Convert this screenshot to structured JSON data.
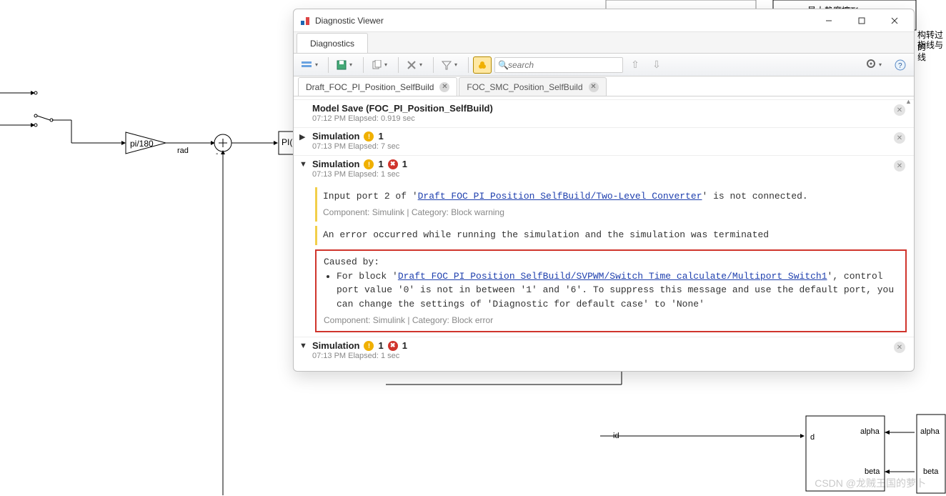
{
  "window": {
    "title": "Diagnostic Viewer",
    "tab": "Diagnostics"
  },
  "toolbar": {
    "search_placeholder": "search"
  },
  "model_tabs": [
    {
      "label": "Draft_FOC_PI_Position_SelfBuild"
    },
    {
      "label": "FOC_SMC_Position_SelfBuild"
    }
  ],
  "entries": {
    "e0": {
      "title": "Model Save (FOC_PI_Position_SelfBuild)",
      "meta": "07:12 PM   Elapsed: 0.919 sec"
    },
    "e1": {
      "title_prefix": "Simulation",
      "warn_count": "1",
      "meta": "07:13 PM   Elapsed: 7 sec"
    },
    "e2": {
      "title_prefix": "Simulation",
      "warn_count": "1",
      "err_count": "1",
      "meta": "07:13 PM   Elapsed: 1 sec",
      "warning": {
        "pre": "Input port 2 of '",
        "link": "Draft_FOC_PI_Position_SelfBuild/Two-Level Converter",
        "post": "' is not connected.",
        "footer": "Component:  Simulink | Category:  Block warning"
      },
      "errmsg_hdr": "An error occurred while running the simulation and the simulation was terminated",
      "causedby": "Caused by:",
      "err_pre": "For block '",
      "err_link": "Draft_FOC_PI_Position_SelfBuild/SVPWM/Switch Time calculate/Multiport Switch1",
      "err_post": "', control port value '0' is not in between '1' and '6'. To suppress this message and use the default port, you can change the settings of 'Diagnostic for default case' to 'None'",
      "err_footer": "Component:  Simulink | Category:  Block error"
    },
    "e3": {
      "title_prefix": "Simulation",
      "warn_count": "1",
      "err_count": "1",
      "meta": "07:13 PM   Elapsed: 1 sec"
    }
  },
  "bg": {
    "pi180": "pi/180",
    "rad": "rad",
    "pi_block": "PI(",
    "tf": "最大静摩擦Tf",
    "rightnote1": "构转过的",
    "rightnote2": "指线与线",
    "id": "id",
    "d": "d",
    "alpha": "alpha",
    "beta": "beta",
    "alpha2": "alpha",
    "beta2": "beta"
  },
  "watermark": "CSDN @龙贼王国的萝卜"
}
